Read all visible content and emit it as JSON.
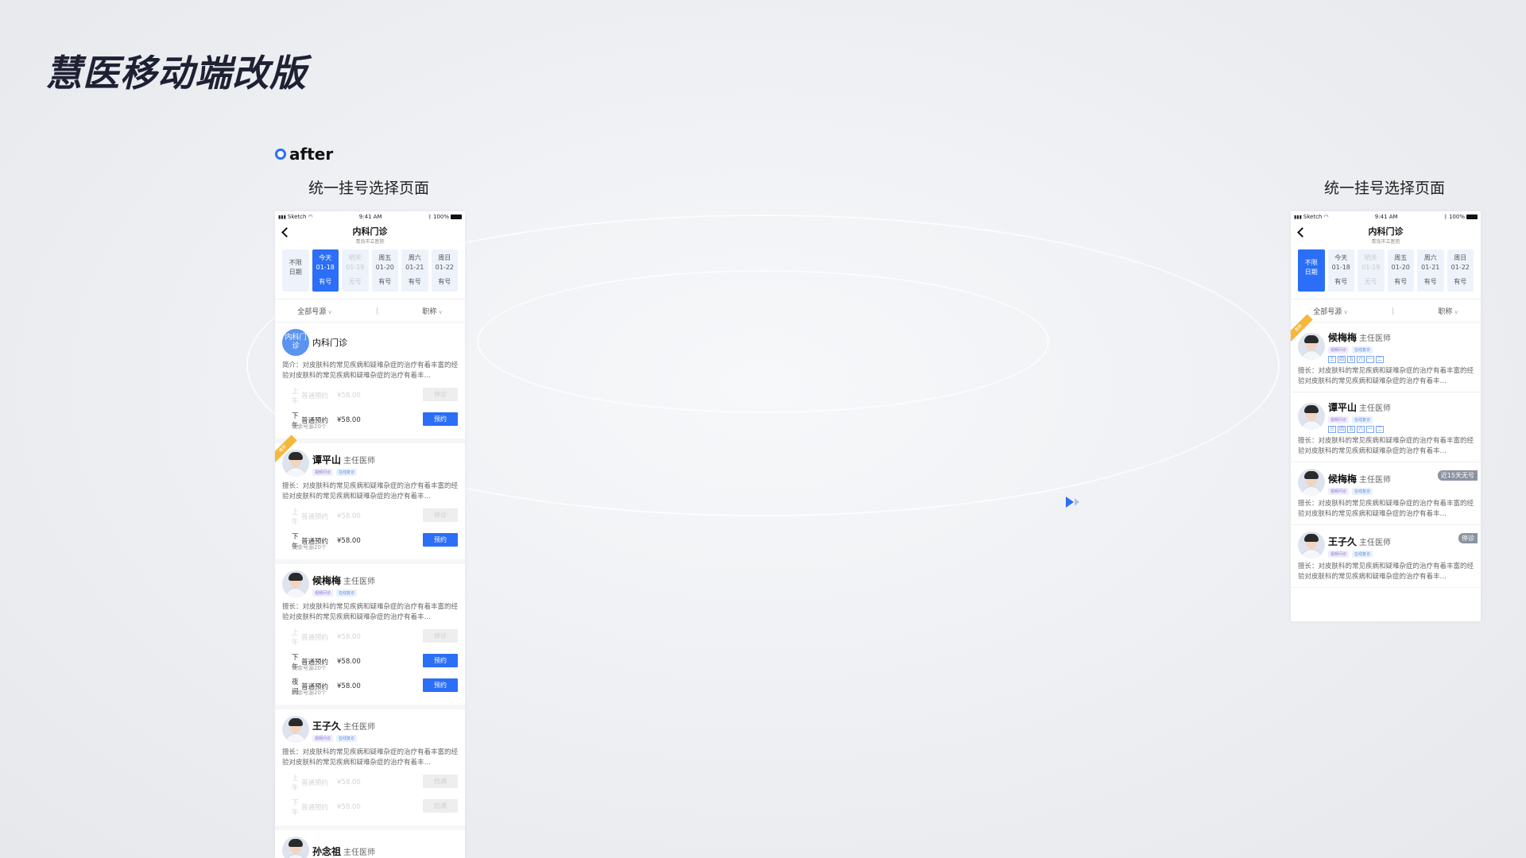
{
  "page_title": "慧医移动端改版",
  "after_label": "after",
  "left": {
    "section_title": "统一挂号选择页面",
    "status": {
      "carrier": "Sketch",
      "time": "9:41 AM",
      "battery": "100%"
    },
    "nav": {
      "title": "内科门诊",
      "subtitle": "青岛市立医院"
    },
    "dates": [
      {
        "line1": "不限",
        "line2": "日期",
        "status": "",
        "state": "normal"
      },
      {
        "line1": "今天",
        "line2": "01-18",
        "status": "有号",
        "state": "active"
      },
      {
        "line1": "明天",
        "line2": "01-19",
        "status": "无号",
        "state": "disabled"
      },
      {
        "line1": "周五",
        "line2": "01-20",
        "status": "有号",
        "state": "normal"
      },
      {
        "line1": "周六",
        "line2": "01-21",
        "status": "有号",
        "state": "normal"
      },
      {
        "line1": "周日",
        "line2": "01-22",
        "status": "有号",
        "state": "normal"
      }
    ],
    "filters": {
      "source": "全部号源",
      "title": "职称"
    },
    "dept_card": {
      "avatar_text": "内科门诊",
      "name": "内科门诊",
      "bio": "简介：对皮肤科的常见疾病和疑难杂症的治疗有着丰富的经验对皮肤科的常见疾病和疑难杂症的治疗有着丰…",
      "slots": [
        {
          "period": "上午",
          "type": "普通预约",
          "price": "¥58.00",
          "remain": "…",
          "btn": "停诊",
          "off": true
        },
        {
          "period": "下午",
          "type": "普通预约",
          "price": "¥58.00",
          "remain": "剩余号源20个",
          "btn": "预约",
          "off": false
        }
      ]
    },
    "doctors": [
      {
        "name": "谭平山",
        "title": "主任医师",
        "ribbon": "推荐",
        "tags": [
          "视频问诊",
          "在线复诊"
        ],
        "bio": "擅长：对皮肤科的常见疾病和疑难杂症的治疗有着丰富的经验对皮肤科的常见疾病和疑难杂症的治疗有着丰…",
        "slots": [
          {
            "period": "上午",
            "type": "普通预约",
            "price": "¥58.00",
            "remain": "…",
            "btn": "停诊",
            "off": true
          },
          {
            "period": "下午",
            "type": "普通预约",
            "price": "¥58.00",
            "remain": "剩余号源20个",
            "btn": "预约",
            "off": false
          }
        ]
      },
      {
        "name": "候梅梅",
        "title": "主任医师",
        "ribbon": "",
        "tags": [
          "视频问诊",
          "在线复诊"
        ],
        "bio": "擅长：对皮肤科的常见疾病和疑难杂症的治疗有着丰富的经验对皮肤科的常见疾病和疑难杂症的治疗有着丰…",
        "slots": [
          {
            "period": "上午",
            "type": "普通预约",
            "price": "¥58.00",
            "remain": "…",
            "btn": "停诊",
            "off": true
          },
          {
            "period": "下午",
            "type": "普通预约",
            "price": "¥58.00",
            "remain": "剩余号源20个",
            "btn": "预约",
            "off": false
          },
          {
            "period": "夜间",
            "type": "普通预约",
            "price": "¥58.00",
            "remain": "剩余号源20个",
            "btn": "预约",
            "off": false
          }
        ]
      },
      {
        "name": "王子久",
        "title": "主任医师",
        "ribbon": "",
        "tags": [
          "视频问诊",
          "在线复诊"
        ],
        "bio": "擅长：对皮肤科的常见疾病和疑难杂症的治疗有着丰富的经验对皮肤科的常见疾病和疑难杂症的治疗有着丰…",
        "slots": [
          {
            "period": "上午",
            "type": "普通预约",
            "price": "¥58.00",
            "remain": "…",
            "btn": "约满",
            "off": true
          },
          {
            "period": "下午",
            "type": "普通预约",
            "price": "¥58.00",
            "remain": "…",
            "btn": "约满",
            "off": true
          }
        ]
      },
      {
        "name": "孙念祖",
        "title": "主任医师",
        "ribbon": "",
        "tags": [],
        "bio": "",
        "slots": []
      }
    ]
  },
  "right": {
    "section_title": "统一挂号选择页面",
    "status": {
      "carrier": "Sketch",
      "time": "9:41 AM",
      "battery": "100%"
    },
    "nav": {
      "title": "内科门诊",
      "subtitle": "青岛市立医院"
    },
    "dates": [
      {
        "line1": "不限",
        "line2": "日期",
        "status": "",
        "state": "active"
      },
      {
        "line1": "今天",
        "line2": "01-18",
        "status": "有号",
        "state": "normal"
      },
      {
        "line1": "明天",
        "line2": "01-19",
        "status": "无号",
        "state": "disabled"
      },
      {
        "line1": "周五",
        "line2": "01-20",
        "status": "有号",
        "state": "normal"
      },
      {
        "line1": "周六",
        "line2": "01-21",
        "status": "有号",
        "state": "normal"
      },
      {
        "line1": "周日",
        "line2": "01-22",
        "status": "有号",
        "state": "normal"
      }
    ],
    "filters": {
      "source": "全部号源",
      "title": "职称"
    },
    "doctors": [
      {
        "name": "候梅梅",
        "title": "主任医师",
        "ribbon": "推荐",
        "badge": "",
        "tags": [
          "视频问诊",
          "在线复诊"
        ],
        "weekdays": [
          "三",
          "四",
          "五",
          "六",
          "一",
          "二"
        ],
        "bio": "擅长：对皮肤科的常见疾病和疑难杂症的治疗有着丰富的经验对皮肤科的常见疾病和疑难杂症的治疗有着丰…"
      },
      {
        "name": "谭平山",
        "title": "主任医师",
        "ribbon": "",
        "badge": "",
        "tags": [
          "视频问诊",
          "在线复诊"
        ],
        "weekdays": [
          "三",
          "四",
          "五",
          "六",
          "一",
          "二"
        ],
        "bio": "擅长：对皮肤科的常见疾病和疑难杂症的治疗有着丰富的经验对皮肤科的常见疾病和疑难杂症的治疗有着丰…"
      },
      {
        "name": "候梅梅",
        "title": "主任医师",
        "ribbon": "",
        "badge": "近15天无号",
        "tags": [
          "视频问诊",
          "在线复诊"
        ],
        "weekdays": [],
        "bio": "擅长：对皮肤科的常见疾病和疑难杂症的治疗有着丰富的经验对皮肤科的常见疾病和疑难杂症的治疗有着丰…"
      },
      {
        "name": "王子久",
        "title": "主任医师",
        "ribbon": "",
        "badge": "停诊",
        "tags": [
          "视频问诊",
          "在线复诊"
        ],
        "weekdays": [],
        "bio": "擅长：对皮肤科的常见疾病和疑难杂症的治疗有着丰富的经验对皮肤科的常见疾病和疑难杂症的治疗有着丰…"
      }
    ]
  },
  "colors": {
    "accent": "#2b6ef7",
    "ribbon": "#f6b73c",
    "title": "#1e2033"
  },
  "icons": {
    "arrow": "play-arrow-icon",
    "back": "back-chevron-icon",
    "wifi": "wifi-icon",
    "battery": "battery-icon",
    "bluetooth": "bluetooth-icon"
  }
}
